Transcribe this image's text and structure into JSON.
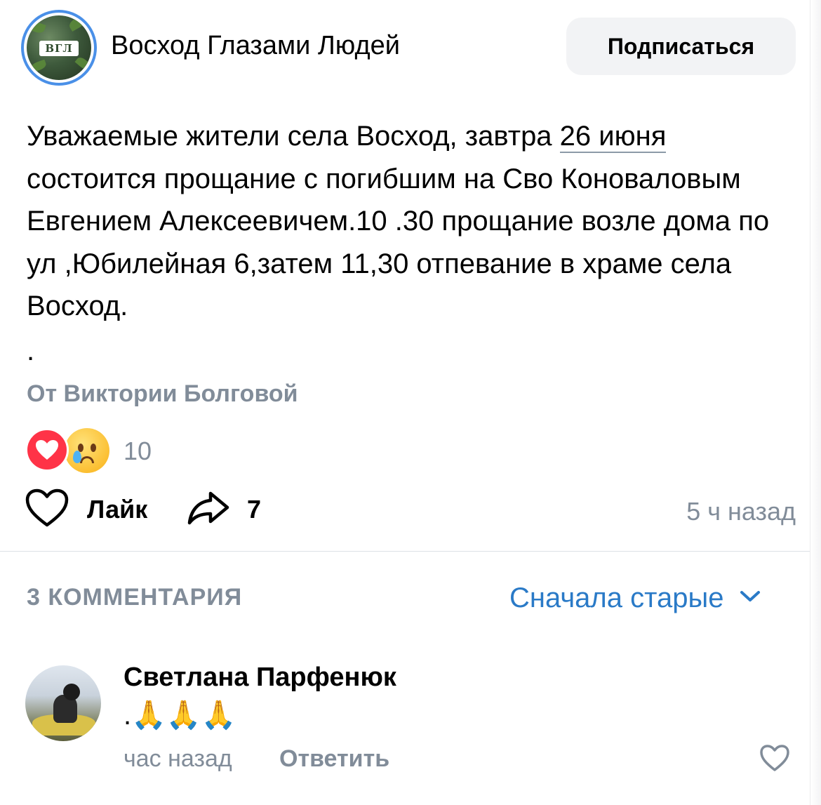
{
  "group": {
    "name": "Восход Глазами Людей",
    "avatar_text": "ВГЛ",
    "subscribe_label": "Подписаться"
  },
  "post": {
    "text_before_link": "Уважаемые жители села Восход, завтра ",
    "date_link": "26 июня",
    "text_after_link": " состоится прощание с погибшим на Сво Коноваловым Евгением Алексеевичем.10 .30 прощание возле дома по ул ,Юбилейная 6,затем 11,30 отпевание в храме села Восход.",
    "trailing": ".",
    "author": "От Виктории Болговой",
    "reactions_count": "10",
    "like_label": "Лайк",
    "share_count": "7",
    "time": "5 ч назад"
  },
  "comments": {
    "count_label": "3 КОММЕНТАРИЯ",
    "sort_label": "Сначала старые",
    "items": [
      {
        "author": "Светлана Парфенюк",
        "text": ".🙏🙏🙏",
        "time": "час назад",
        "reply_label": "Ответить"
      }
    ]
  },
  "colors": {
    "accent": "#2a7ac7",
    "secondary_text": "#818c99",
    "heart": "#ff3347",
    "button_bg": "#f2f3f5",
    "avatar_ring": "#4a90e8"
  },
  "icons": [
    "heart-icon",
    "share-arrow-icon",
    "chevron-down-icon",
    "heart-outline-icon",
    "crying-face-icon"
  ]
}
